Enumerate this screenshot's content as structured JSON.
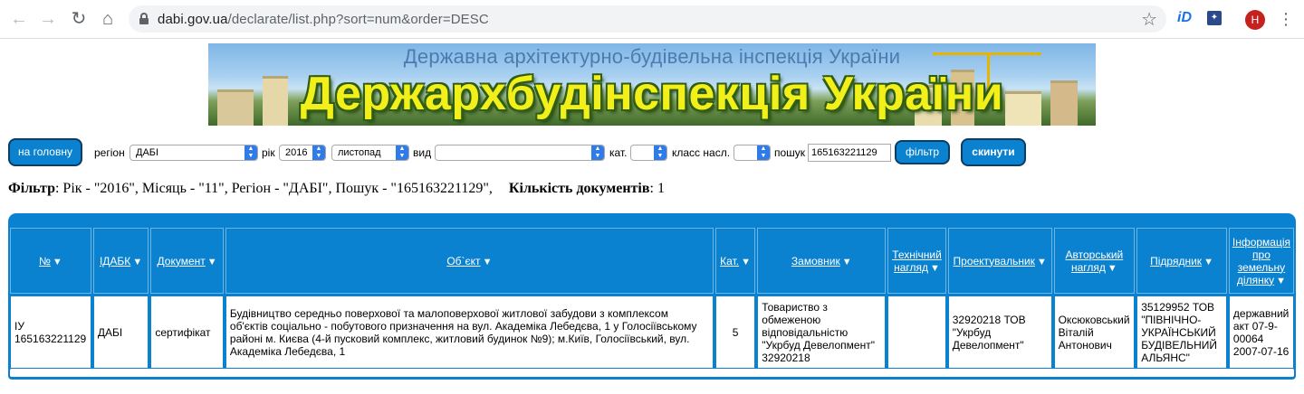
{
  "browser": {
    "url_host": "dabi.gov.ua",
    "url_path": "/declarate/list.php?sort=num&order=DESC",
    "profile_initial": "H",
    "ext1": "iD"
  },
  "banner": {
    "subtitle": "Державна архітектурно-будівельна інспекція України",
    "title": "Держархбудінспекція України"
  },
  "filters": {
    "home_label": "на головну",
    "region_label": "регіон",
    "region_value": "ДАБІ",
    "year_label": "рік",
    "year_value": "2016",
    "month_value": "листопад",
    "type_label": "вид",
    "type_value": "",
    "cat_label": "кат.",
    "cat_value": "",
    "class_label": "класс насл.",
    "class_value": "",
    "search_label": "пошук",
    "search_value": "165163221129",
    "filter_button": "фільтр",
    "reset_button": "скинути"
  },
  "summary": {
    "filter_label": "Фільтр",
    "filter_text": ": Рік - \"2016\", Місяць - \"11\", Регіон - \"ДАБІ\", Пошук - \"165163221129\",",
    "count_label": "Кількість документів",
    "count_value": ": 1"
  },
  "table": {
    "columns": [
      "№",
      "ІДАБК",
      "Документ",
      "Об`єкт",
      "Кат.",
      "Замовник",
      "Технічний нагляд",
      "Проектувальник",
      "Авторський нагляд",
      "Підрядник",
      "Інформація про земельну ділянку"
    ],
    "rows": [
      {
        "num": "ІУ 165163221129",
        "idabk": "ДАБІ",
        "doc": "сертифікат",
        "object": "Будівництво середньо поверхової та малоповерхової житлової забудови з комплексом об'єктів соціально - побутового призначення на вул. Академіка Лебедєва, 1 у Голосіївському районі м. Києва (4-й пусковий комплекс, житловий будинок №9); м.Київ, Голосіївський, вул. Академіка Лебедєва, 1",
        "cat": "5",
        "customer": "Товариство з обмеженою відповідальністю \"Укрбуд Девелопмент\" 32920218",
        "tech": "",
        "designer": "32920218 ТОВ \"Укрбуд Девелопмент\"",
        "author": "Оксюковський Віталій Антонович",
        "contractor": "35129952 ТОВ \"ПІВНІЧНО-УКРАЇНСЬКИЙ БУДІВЕЛЬНИЙ АЛЬЯНС\"",
        "land": "державний акт 07-9-00064 2007-07-16"
      }
    ]
  }
}
